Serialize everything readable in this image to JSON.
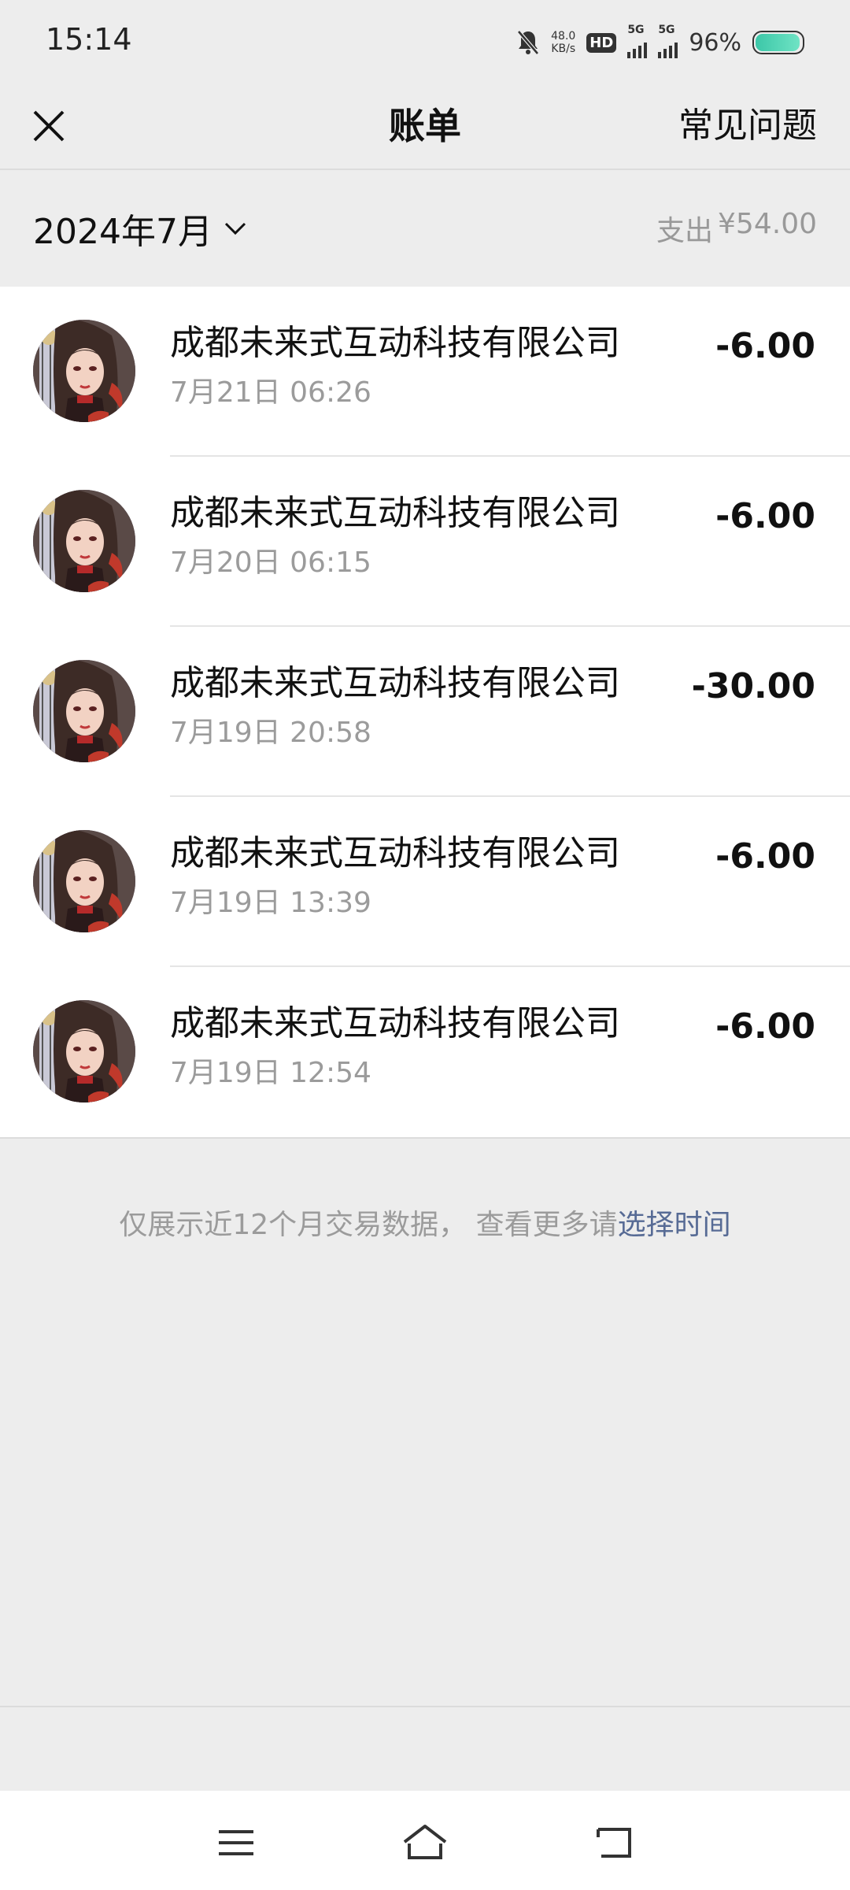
{
  "status_bar": {
    "time": "15:14",
    "net_speed_value": "48.0",
    "net_speed_unit": "KB/s",
    "hd_label": "HD",
    "signal1_label": "5G",
    "signal2_label": "5G",
    "battery_percent": "96%",
    "battery_level": 0.96,
    "icons": [
      "mute-bell-icon",
      "signal-icon",
      "signal-icon",
      "battery-icon"
    ]
  },
  "header": {
    "title": "账单",
    "faq_label": "常见问题",
    "close_icon": "close-icon"
  },
  "month_bar": {
    "month": "2024年7月",
    "spend_label": "支出",
    "spend_amount": "¥54.00"
  },
  "transactions": [
    {
      "merchant": "成都未来式互动科技有限公司",
      "time": "7月21日 06:26",
      "amount": "-6.00"
    },
    {
      "merchant": "成都未来式互动科技有限公司",
      "time": "7月20日 06:15",
      "amount": "-6.00"
    },
    {
      "merchant": "成都未来式互动科技有限公司",
      "time": "7月19日 20:58",
      "amount": "-30.00"
    },
    {
      "merchant": "成都未来式互动科技有限公司",
      "time": "7月19日 13:39",
      "amount": "-6.00"
    },
    {
      "merchant": "成都未来式互动科技有限公司",
      "time": "7月19日 12:54",
      "amount": "-6.00"
    }
  ],
  "notice": {
    "text": "仅展示近12个月交易数据， 查看更多请",
    "link": "选择时间"
  },
  "colors": {
    "background": "#ededed",
    "link": "#576b95",
    "secondary_text": "#9b9b9b"
  }
}
